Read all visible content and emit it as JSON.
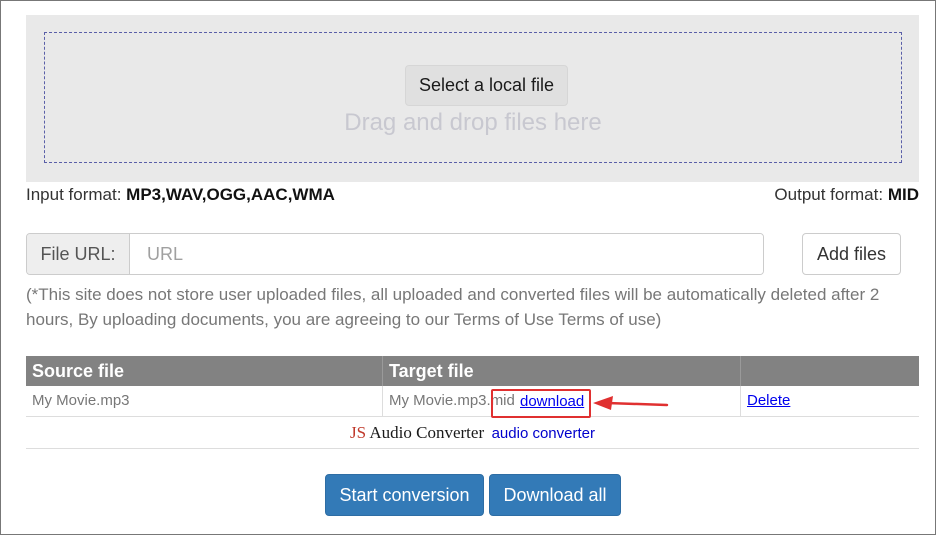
{
  "upload": {
    "select_label": "Select a local file",
    "drag_text": "Drag and drop files here"
  },
  "formats": {
    "input_label": "Input format:",
    "input_value": "MP3,WAV,OGG,AAC,WMA",
    "output_label": "Output format:",
    "output_value": "MID"
  },
  "url": {
    "addon_label": "File URL:",
    "placeholder": "URL",
    "add_label": "Add files"
  },
  "notice": "(*This site does not store user uploaded files, all uploaded and converted files will be automatically deleted after 2 hours, By uploading documents, you are agreeing to our Terms of Use Terms of use)",
  "table": {
    "headers": [
      "Source file",
      "Target file",
      ""
    ],
    "rows": [
      {
        "source": "My Movie.mp3",
        "target": "My Movie.mp3.mid",
        "download_label": "download",
        "delete_label": "Delete"
      }
    ]
  },
  "credit": {
    "logo_js": "JS",
    "logo_rest": " Audio Converter",
    "text": "audio converter"
  },
  "actions": {
    "start_label": "Start conversion",
    "download_all_label": "Download all"
  },
  "colors": {
    "primary": "#337ab7",
    "highlight": "#e03030",
    "link": "#0000ee"
  }
}
